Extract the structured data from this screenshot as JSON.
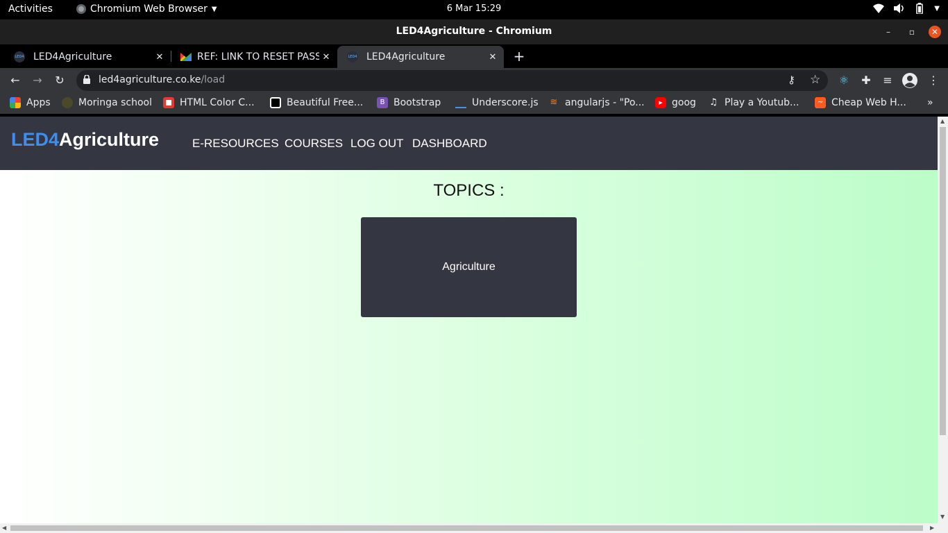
{
  "system_bar": {
    "activities": "Activities",
    "app_name": "Chromium Web Browser",
    "clock": "6 Mar  15:29"
  },
  "window": {
    "title": "LED4Agriculture - Chromium"
  },
  "tabs": [
    {
      "label": "LED4Agriculture",
      "favicon": "LED4"
    },
    {
      "label": "REF: LINK TO RESET PASSWORD"
    },
    {
      "label": "LED4Agriculture",
      "favicon": "LED4"
    }
  ],
  "address_bar": {
    "host": "led4agriculture.co.ke",
    "path": "/load"
  },
  "bookmarks": [
    {
      "label": "Apps"
    },
    {
      "label": "Moringa school"
    },
    {
      "label": "HTML Color C..."
    },
    {
      "label": "Beautiful Free..."
    },
    {
      "label": "Bootstrap",
      "icon_letter": "B"
    },
    {
      "label": "Underscore.js"
    },
    {
      "label": "angularjs - \"Po..."
    },
    {
      "label": "goog"
    },
    {
      "label": "Play a Youtub..."
    },
    {
      "label": "Cheap Web H..."
    }
  ],
  "site": {
    "brand_part1": "LED4",
    "brand_part2": "Agriculture",
    "nav": [
      "E-RESOURCES",
      "COURSES",
      "LOG OUT",
      "DASHBOARD"
    ],
    "topics_heading": "TOPICS :",
    "topics": [
      "Agriculture"
    ]
  },
  "colors": {
    "brand_blue": "#3d8ef0",
    "navbar_bg": "#343741",
    "gradient_end": "#bcfdc9",
    "chrome_close": "#e95420"
  }
}
